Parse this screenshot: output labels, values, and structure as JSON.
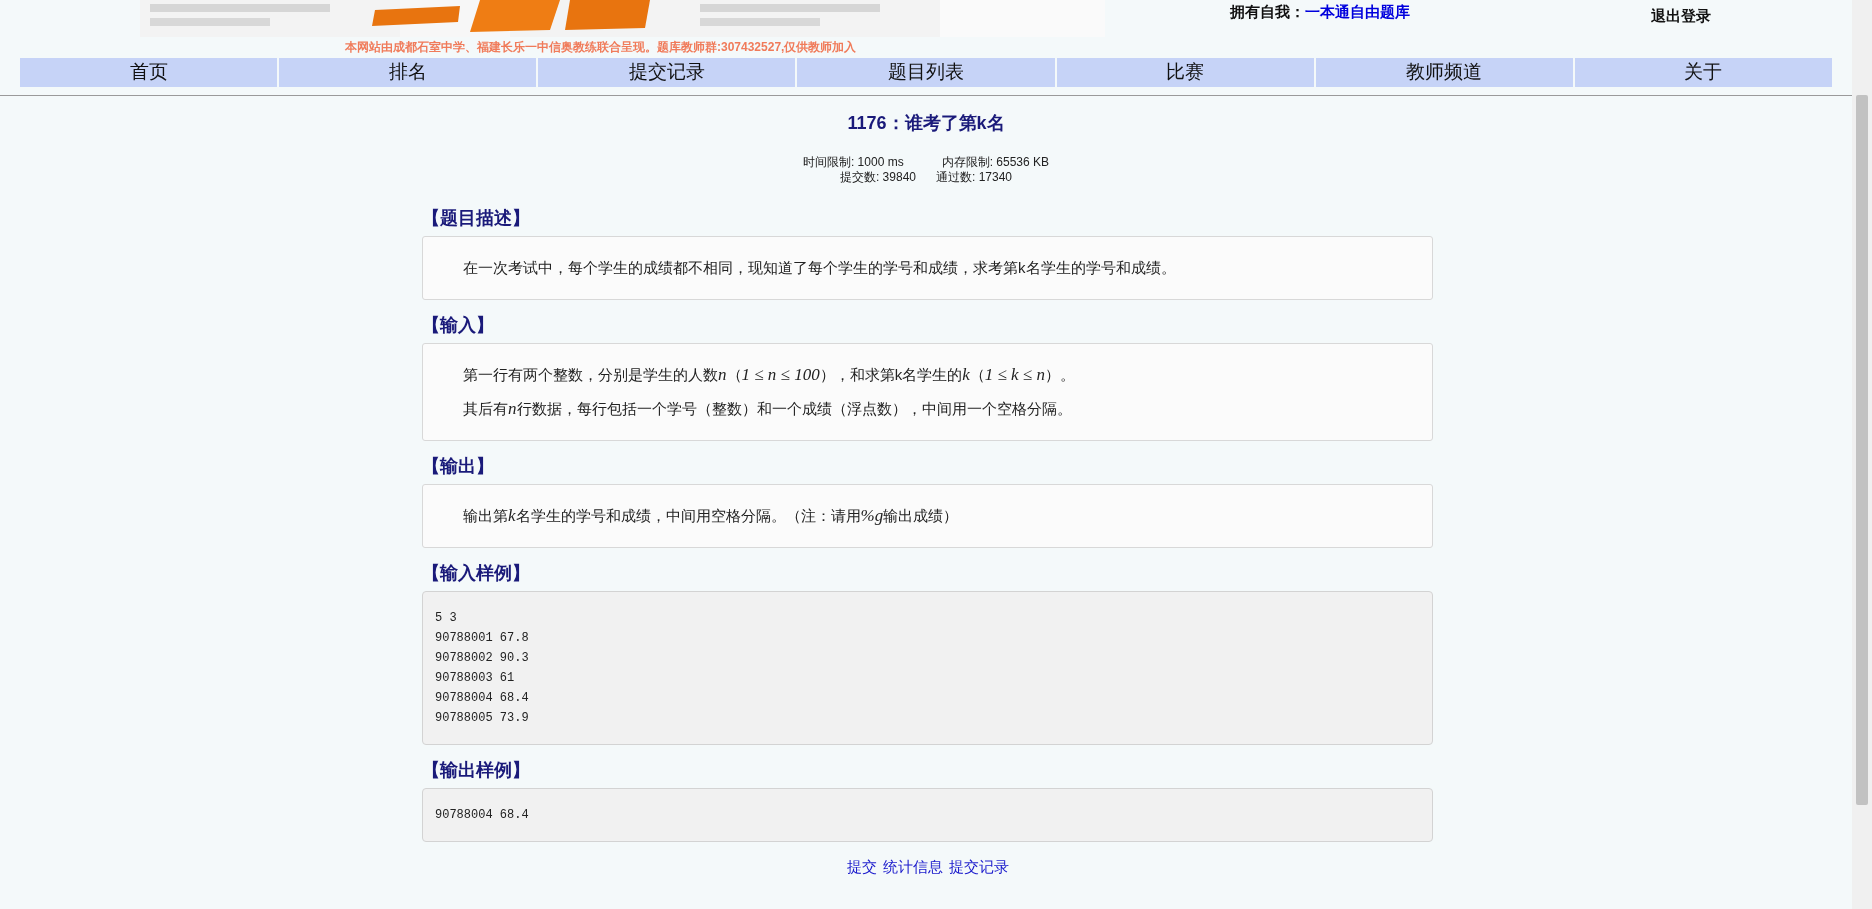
{
  "header": {
    "notice": "本网站由成都石室中学、福建长乐一中信奥教练联合呈现。题库教师群:307432527,仅供教师加入",
    "library_label": "拥有自我：",
    "library_link": "一本通自由题库",
    "logout": "退出登录"
  },
  "nav": [
    {
      "label": "首页"
    },
    {
      "label": "排名"
    },
    {
      "label": "提交记录"
    },
    {
      "label": "题目列表"
    },
    {
      "label": "比赛"
    },
    {
      "label": "教师频道"
    },
    {
      "label": "关于"
    }
  ],
  "problem": {
    "title": "1176：谁考了第k名",
    "time_limit": "时间限制: 1000 ms",
    "memory_limit": "内存限制: 65536 KB",
    "submissions": "提交数: 39840",
    "accepted": "通过数: 17340"
  },
  "sections": [
    {
      "kind": "text",
      "heading": "【题目描述】",
      "paragraphs": [
        [
          {
            "kind": "text",
            "text": "在一次考试中，每个学生的成绩都不相同，现知道了每个学生的学号和成绩，求考第k名学生的学号和成绩。"
          }
        ]
      ]
    },
    {
      "kind": "text",
      "heading": "【输入】",
      "paragraphs": [
        [
          {
            "kind": "text",
            "text": "第一行有两个整数，分别是学生的人数"
          },
          {
            "kind": "math",
            "text": "n"
          },
          {
            "kind": "text",
            "text": "（"
          },
          {
            "kind": "math",
            "text": "1 ≤ n ≤ 100"
          },
          {
            "kind": "text",
            "text": "），和求第k名学生的"
          },
          {
            "kind": "math",
            "text": "k"
          },
          {
            "kind": "text",
            "text": "（"
          },
          {
            "kind": "math",
            "text": "1 ≤ k ≤ n"
          },
          {
            "kind": "text",
            "text": "）。"
          }
        ],
        [
          {
            "kind": "text",
            "text": "其后有"
          },
          {
            "kind": "math",
            "text": "n"
          },
          {
            "kind": "text",
            "text": "行数据，每行包括一个学号（整数）和一个成绩（浮点数），中间用一个空格分隔。"
          }
        ]
      ]
    },
    {
      "kind": "text",
      "heading": "【输出】",
      "paragraphs": [
        [
          {
            "kind": "text",
            "text": "输出第"
          },
          {
            "kind": "math",
            "text": "k"
          },
          {
            "kind": "text",
            "text": "名学生的学号和成绩，中间用空格分隔。（注：请用"
          },
          {
            "kind": "math",
            "text": "%g"
          },
          {
            "kind": "text",
            "text": "输出成绩）"
          }
        ]
      ]
    },
    {
      "kind": "code",
      "heading": "【输入样例】",
      "lines": [
        "5 3",
        "90788001 67.8",
        "90788002 90.3",
        "90788003 61",
        "90788004 68.4",
        "90788005 73.9"
      ]
    },
    {
      "kind": "code",
      "heading": "【输出样例】",
      "lines": [
        "90788004 68.4"
      ]
    }
  ],
  "links": [
    "提交",
    "统计信息",
    "提交记录"
  ]
}
